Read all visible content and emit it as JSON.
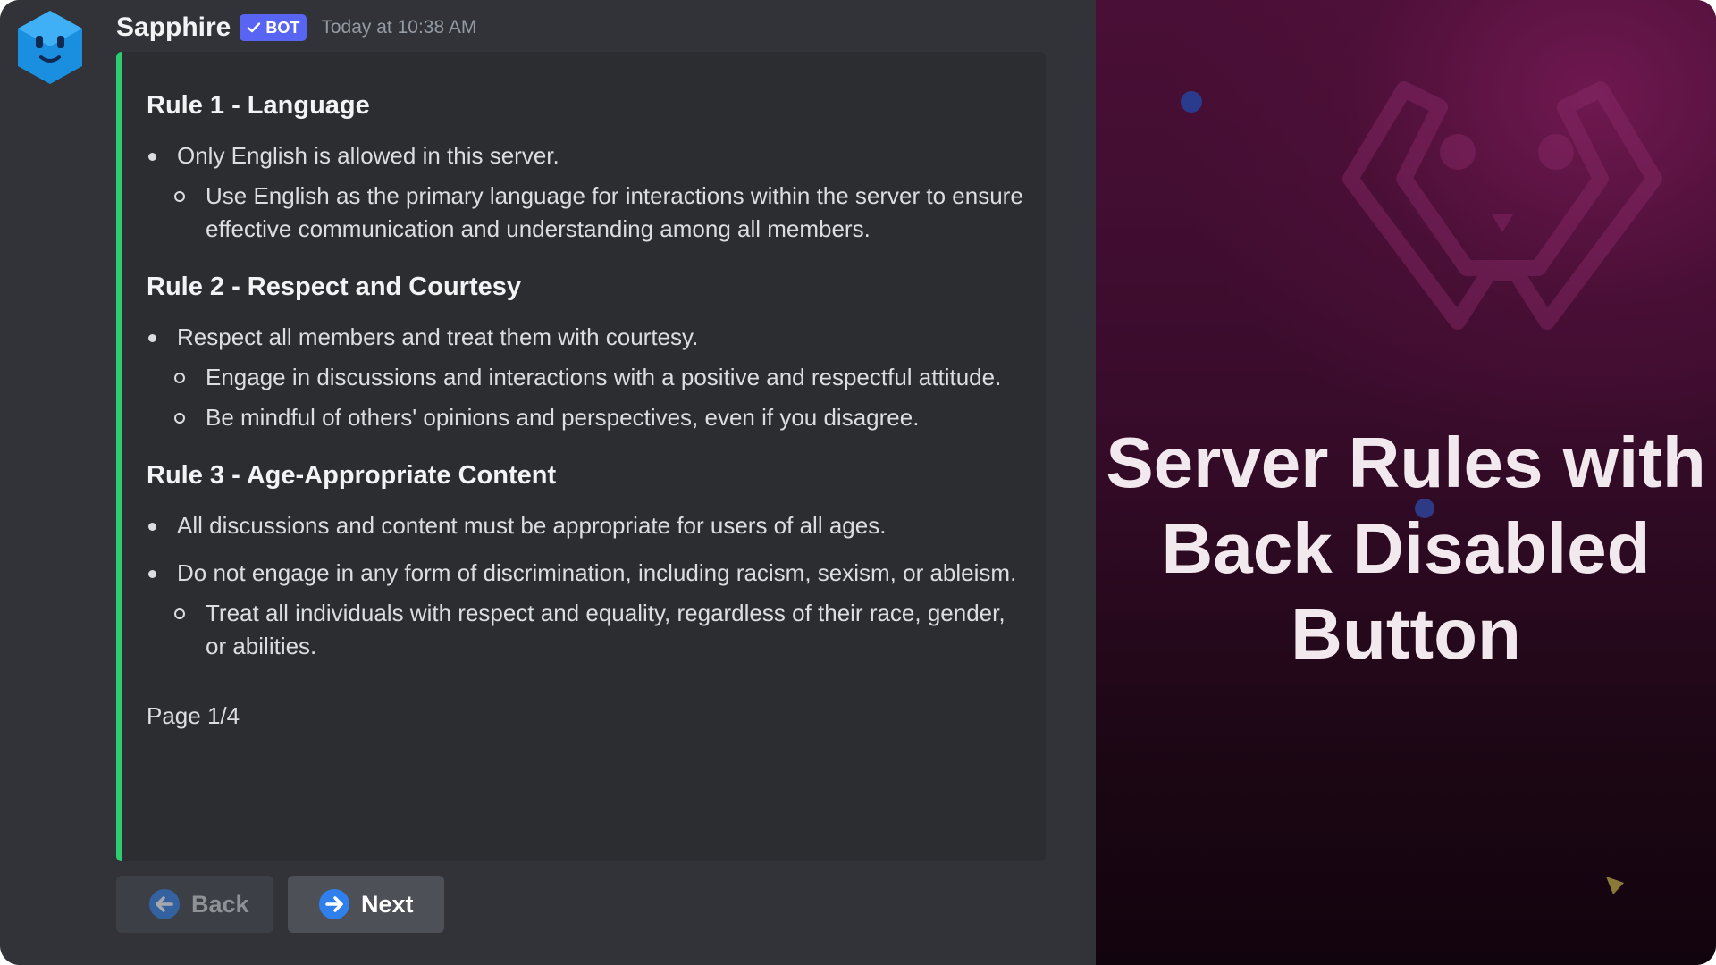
{
  "message": {
    "author": "Sapphire",
    "bot_tag": "BOT",
    "timestamp": "Today at 10:38 AM",
    "accent_color": "#2ecc71"
  },
  "rules": [
    {
      "title": "Rule 1 - Language",
      "items": [
        {
          "text": "Only English is allowed in this server.",
          "sub": [
            "Use English as the primary language for interactions within the server to ensure effective communication and understanding among all members."
          ]
        }
      ]
    },
    {
      "title": "Rule 2 - Respect and Courtesy",
      "items": [
        {
          "text": "Respect all members and treat them with courtesy.",
          "sub": [
            "Engage in discussions and interactions with a positive and respectful attitude.",
            "Be mindful of others' opinions and perspectives, even if you disagree."
          ]
        }
      ]
    },
    {
      "title": "Rule 3 - Age-Appropriate Content",
      "items": [
        {
          "text": "All discussions and content must be appropriate for users of all ages.",
          "sub": []
        },
        {
          "text": "Do not engage in any form of discrimination, including racism, sexism, or ableism.",
          "sub": [
            "Treat all individuals with respect and equality, regardless of their race, gender, or abilities."
          ]
        }
      ]
    }
  ],
  "footer": {
    "page": "Page 1/4"
  },
  "buttons": {
    "back": {
      "label": "Back",
      "disabled": true,
      "icon": "arrow-left-icon"
    },
    "next": {
      "label": "Next",
      "disabled": false,
      "icon": "arrow-right-icon"
    }
  },
  "promo": {
    "title_lines": [
      "Server Rules with",
      "Back Disabled",
      "Button"
    ]
  }
}
